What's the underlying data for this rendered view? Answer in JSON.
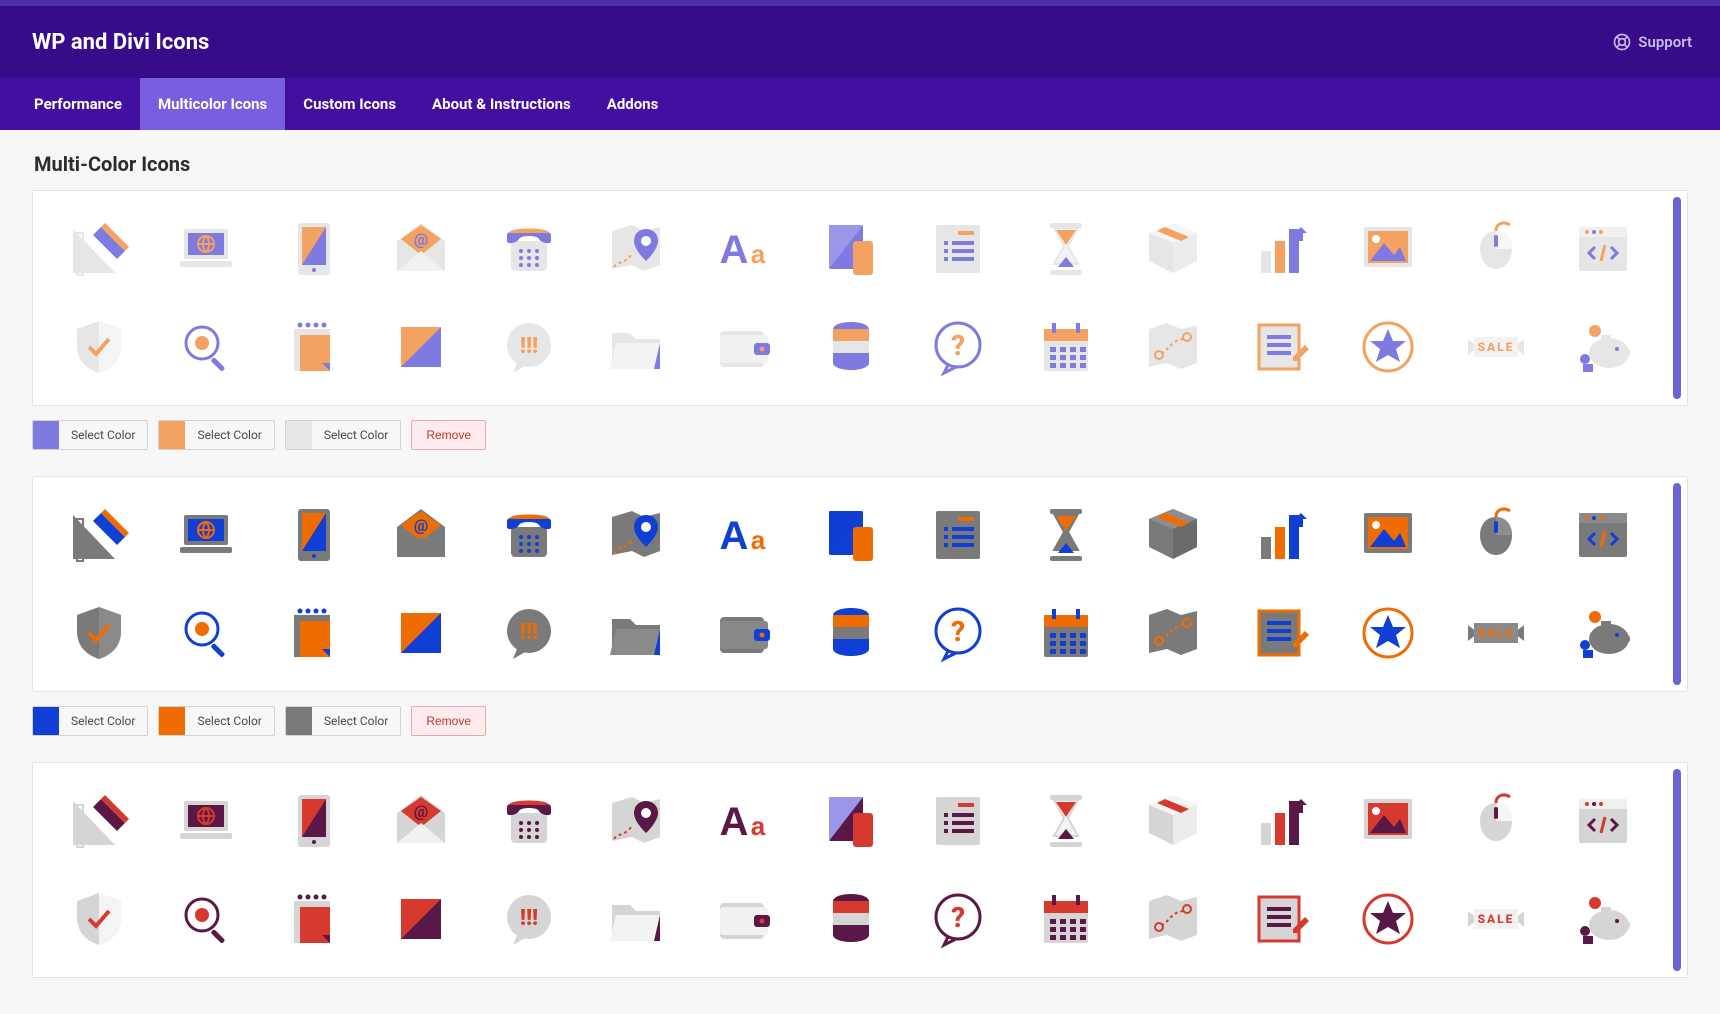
{
  "header": {
    "title": "WP and Divi Icons",
    "support_label": "Support"
  },
  "tabs": [
    {
      "label": "Performance",
      "active": false
    },
    {
      "label": "Multicolor Icons",
      "active": true
    },
    {
      "label": "Custom Icons",
      "active": false
    },
    {
      "label": "About & Instructions",
      "active": false
    },
    {
      "label": "Addons",
      "active": false
    }
  ],
  "section_title": "Multi-Color Icons",
  "icons": [
    "pencil-ruler",
    "laptop-globe",
    "tablet",
    "envelope-at",
    "desk-phone",
    "map-pin",
    "font-aa",
    "phone-device",
    "list",
    "hourglass",
    "box-3d",
    "bar-chart",
    "picture",
    "mouse",
    "code-window",
    "shield-check",
    "magnifier",
    "notepad",
    "square-flat",
    "speech-alert",
    "folder",
    "wallet",
    "database",
    "question-bubble",
    "calendar",
    "route-map",
    "edit-list",
    "star-badge",
    "sale-ribbon",
    "savings"
  ],
  "sets": [
    {
      "colors": [
        "#7e7ae0",
        "#f4a261",
        "#e6e6e6"
      ],
      "light": true,
      "stripe": "#6a65d6"
    },
    {
      "colors": [
        "#103fd6",
        "#ef6c00",
        "#7a7a7a"
      ],
      "light": false,
      "stripe": "#6a65d6"
    },
    {
      "colors": [
        "#5a1846",
        "#d63a2f",
        "#d5d5d5"
      ],
      "light": true,
      "stripe": "#6a65d6"
    }
  ],
  "picker_label": "Select Color",
  "remove_label": "Remove"
}
